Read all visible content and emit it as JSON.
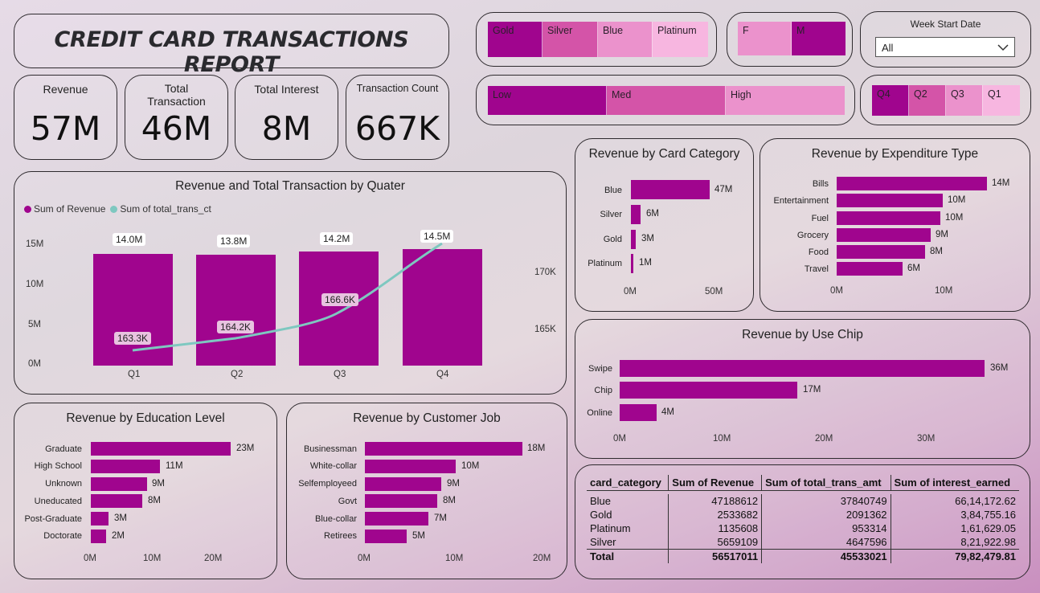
{
  "report_title": "CREDIT CARD TRANSACTIONS REPORT",
  "colors": {
    "bar": "#a0058e",
    "line": "#7ec8c0",
    "slicer_dark": "#a0058e",
    "slicer_mid": "#d454a8",
    "slicer_light": "#eb92cc",
    "slicer_lightest": "#f7b6e0"
  },
  "kpis": [
    {
      "label": "Revenue",
      "value": "57M"
    },
    {
      "label": "Total\nTransaction",
      "value": "46M"
    },
    {
      "label": "Total Interest",
      "value": "8M"
    },
    {
      "label": "Transaction Count",
      "value": "667K"
    }
  ],
  "slicers": {
    "card_category": [
      "Gold",
      "Silver",
      "Blue",
      "Platinum"
    ],
    "gender": [
      "F",
      "M"
    ],
    "income_group": [
      "Low",
      "Med",
      "High"
    ],
    "quarter": [
      "Q4",
      "Q2",
      "Q3",
      "Q1"
    ],
    "week_start": {
      "label": "Week Start Date",
      "value": "All"
    }
  },
  "charts": {
    "quarter": {
      "title": "Revenue and Total Transaction by Quater",
      "legend": [
        "Sum of Revenue",
        "Sum of total_trans_ct"
      ],
      "y_ticks": [
        "15M",
        "10M",
        "5M",
        "0M"
      ],
      "y2_ticks": [
        "170K",
        "165K"
      ],
      "bar_labels": [
        "14.0M",
        "13.8M",
        "14.2M",
        "14.5M"
      ],
      "line_labels": [
        "163.3K",
        "164.2K",
        "166.6K",
        "14.5M"
      ],
      "categories": [
        "Q1",
        "Q2",
        "Q3",
        "Q4"
      ]
    },
    "card_category": {
      "title": "Revenue by Card Category",
      "categories": [
        "Blue",
        "Silver",
        "Gold",
        "Platinum"
      ],
      "labels": [
        "47M",
        "6M",
        "3M",
        "1M"
      ],
      "x_ticks": [
        "0M",
        "50M"
      ]
    },
    "expenditure": {
      "title": "Revenue by Expenditure Type",
      "categories": [
        "Bills",
        "Entertainment",
        "Fuel",
        "Grocery",
        "Food",
        "Travel"
      ],
      "labels": [
        "14M",
        "10M",
        "10M",
        "9M",
        "8M",
        "6M"
      ],
      "x_ticks": [
        "0M",
        "10M"
      ]
    },
    "use_chip": {
      "title": "Revenue by Use Chip",
      "categories": [
        "Swipe",
        "Chip",
        "Online"
      ],
      "labels": [
        "36M",
        "17M",
        "4M"
      ],
      "x_ticks": [
        "0M",
        "10M",
        "20M",
        "30M"
      ]
    },
    "education": {
      "title": "Revenue by Education Level",
      "categories": [
        "Graduate",
        "High School",
        "Unknown",
        "Uneducated",
        "Post-Graduate",
        "Doctorate"
      ],
      "labels": [
        "23M",
        "11M",
        "9M",
        "8M",
        "3M",
        "2M"
      ],
      "x_ticks": [
        "0M",
        "10M",
        "20M"
      ]
    },
    "job": {
      "title": "Revenue by Customer Job",
      "categories": [
        "Businessman",
        "White-collar",
        "Selfemployeed",
        "Govt",
        "Blue-collar",
        "Retirees"
      ],
      "labels": [
        "18M",
        "10M",
        "9M",
        "8M",
        "7M",
        "5M"
      ],
      "x_ticks": [
        "0M",
        "10M",
        "20M"
      ]
    }
  },
  "chart_data": [
    {
      "type": "bar",
      "title": "Revenue and Total Transaction by Quater",
      "categories": [
        "Q1",
        "Q2",
        "Q3",
        "Q4"
      ],
      "series": [
        {
          "name": "Sum of Revenue",
          "values": [
            14.0,
            13.8,
            14.2,
            14.5
          ],
          "unit": "M"
        },
        {
          "name": "Sum of total_trans_ct",
          "type": "line",
          "values": [
            163.3,
            164.2,
            166.6,
            169.3
          ],
          "unit": "K"
        }
      ],
      "ylim": [
        0,
        15
      ],
      "y2lim": [
        162,
        171
      ]
    },
    {
      "type": "bar",
      "orientation": "horizontal",
      "title": "Revenue by Card Category",
      "categories": [
        "Blue",
        "Silver",
        "Gold",
        "Platinum"
      ],
      "values": [
        47,
        6,
        3,
        1
      ],
      "xlim": [
        0,
        50
      ]
    },
    {
      "type": "bar",
      "orientation": "horizontal",
      "title": "Revenue by Expenditure Type",
      "categories": [
        "Bills",
        "Entertainment",
        "Fuel",
        "Grocery",
        "Food",
        "Travel"
      ],
      "values": [
        14,
        10,
        10,
        9,
        8,
        6
      ],
      "xlim": [
        0,
        10
      ]
    },
    {
      "type": "bar",
      "orientation": "horizontal",
      "title": "Revenue by Use Chip",
      "categories": [
        "Swipe",
        "Chip",
        "Online"
      ],
      "values": [
        36,
        17,
        4
      ],
      "xlim": [
        0,
        30
      ]
    },
    {
      "type": "bar",
      "orientation": "horizontal",
      "title": "Revenue by Education Level",
      "categories": [
        "Graduate",
        "High School",
        "Unknown",
        "Uneducated",
        "Post-Graduate",
        "Doctorate"
      ],
      "values": [
        23,
        11,
        9,
        8,
        3,
        2
      ],
      "xlim": [
        0,
        20
      ]
    },
    {
      "type": "bar",
      "orientation": "horizontal",
      "title": "Revenue by Customer Job",
      "categories": [
        "Businessman",
        "White-collar",
        "Selfemployeed",
        "Govt",
        "Blue-collar",
        "Retirees"
      ],
      "values": [
        18,
        10,
        9,
        8,
        7,
        5
      ],
      "xlim": [
        0,
        20
      ]
    },
    {
      "type": "table",
      "columns": [
        "card_category",
        "Sum of Revenue",
        "Sum of total_trans_amt",
        "Sum of interest_earned"
      ],
      "rows": [
        [
          "Blue",
          "47188612",
          "37840749",
          "66,14,172.62"
        ],
        [
          "Gold",
          "2533682",
          "2091362",
          "3,84,755.16"
        ],
        [
          "Platinum",
          "1135608",
          "953314",
          "1,61,629.05"
        ],
        [
          "Silver",
          "5659109",
          "4647596",
          "8,21,922.98"
        ]
      ],
      "total": [
        "Total",
        "56517011",
        "45533021",
        "79,82,479.81"
      ]
    }
  ]
}
